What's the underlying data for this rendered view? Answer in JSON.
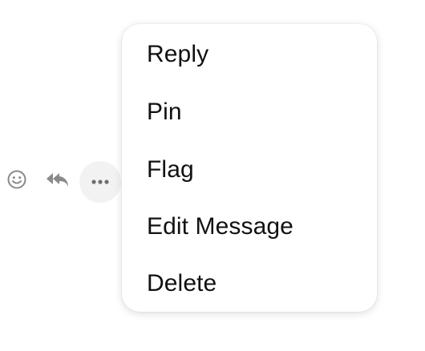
{
  "action_bar": {
    "icons": [
      "smiley-icon",
      "reply-all-icon",
      "more-horizontal-icon"
    ],
    "icon_color": "#8a8a8a"
  },
  "context_menu": {
    "items": [
      {
        "label": "Reply"
      },
      {
        "label": "Pin"
      },
      {
        "label": "Flag"
      },
      {
        "label": "Edit Message"
      },
      {
        "label": "Delete"
      }
    ]
  }
}
